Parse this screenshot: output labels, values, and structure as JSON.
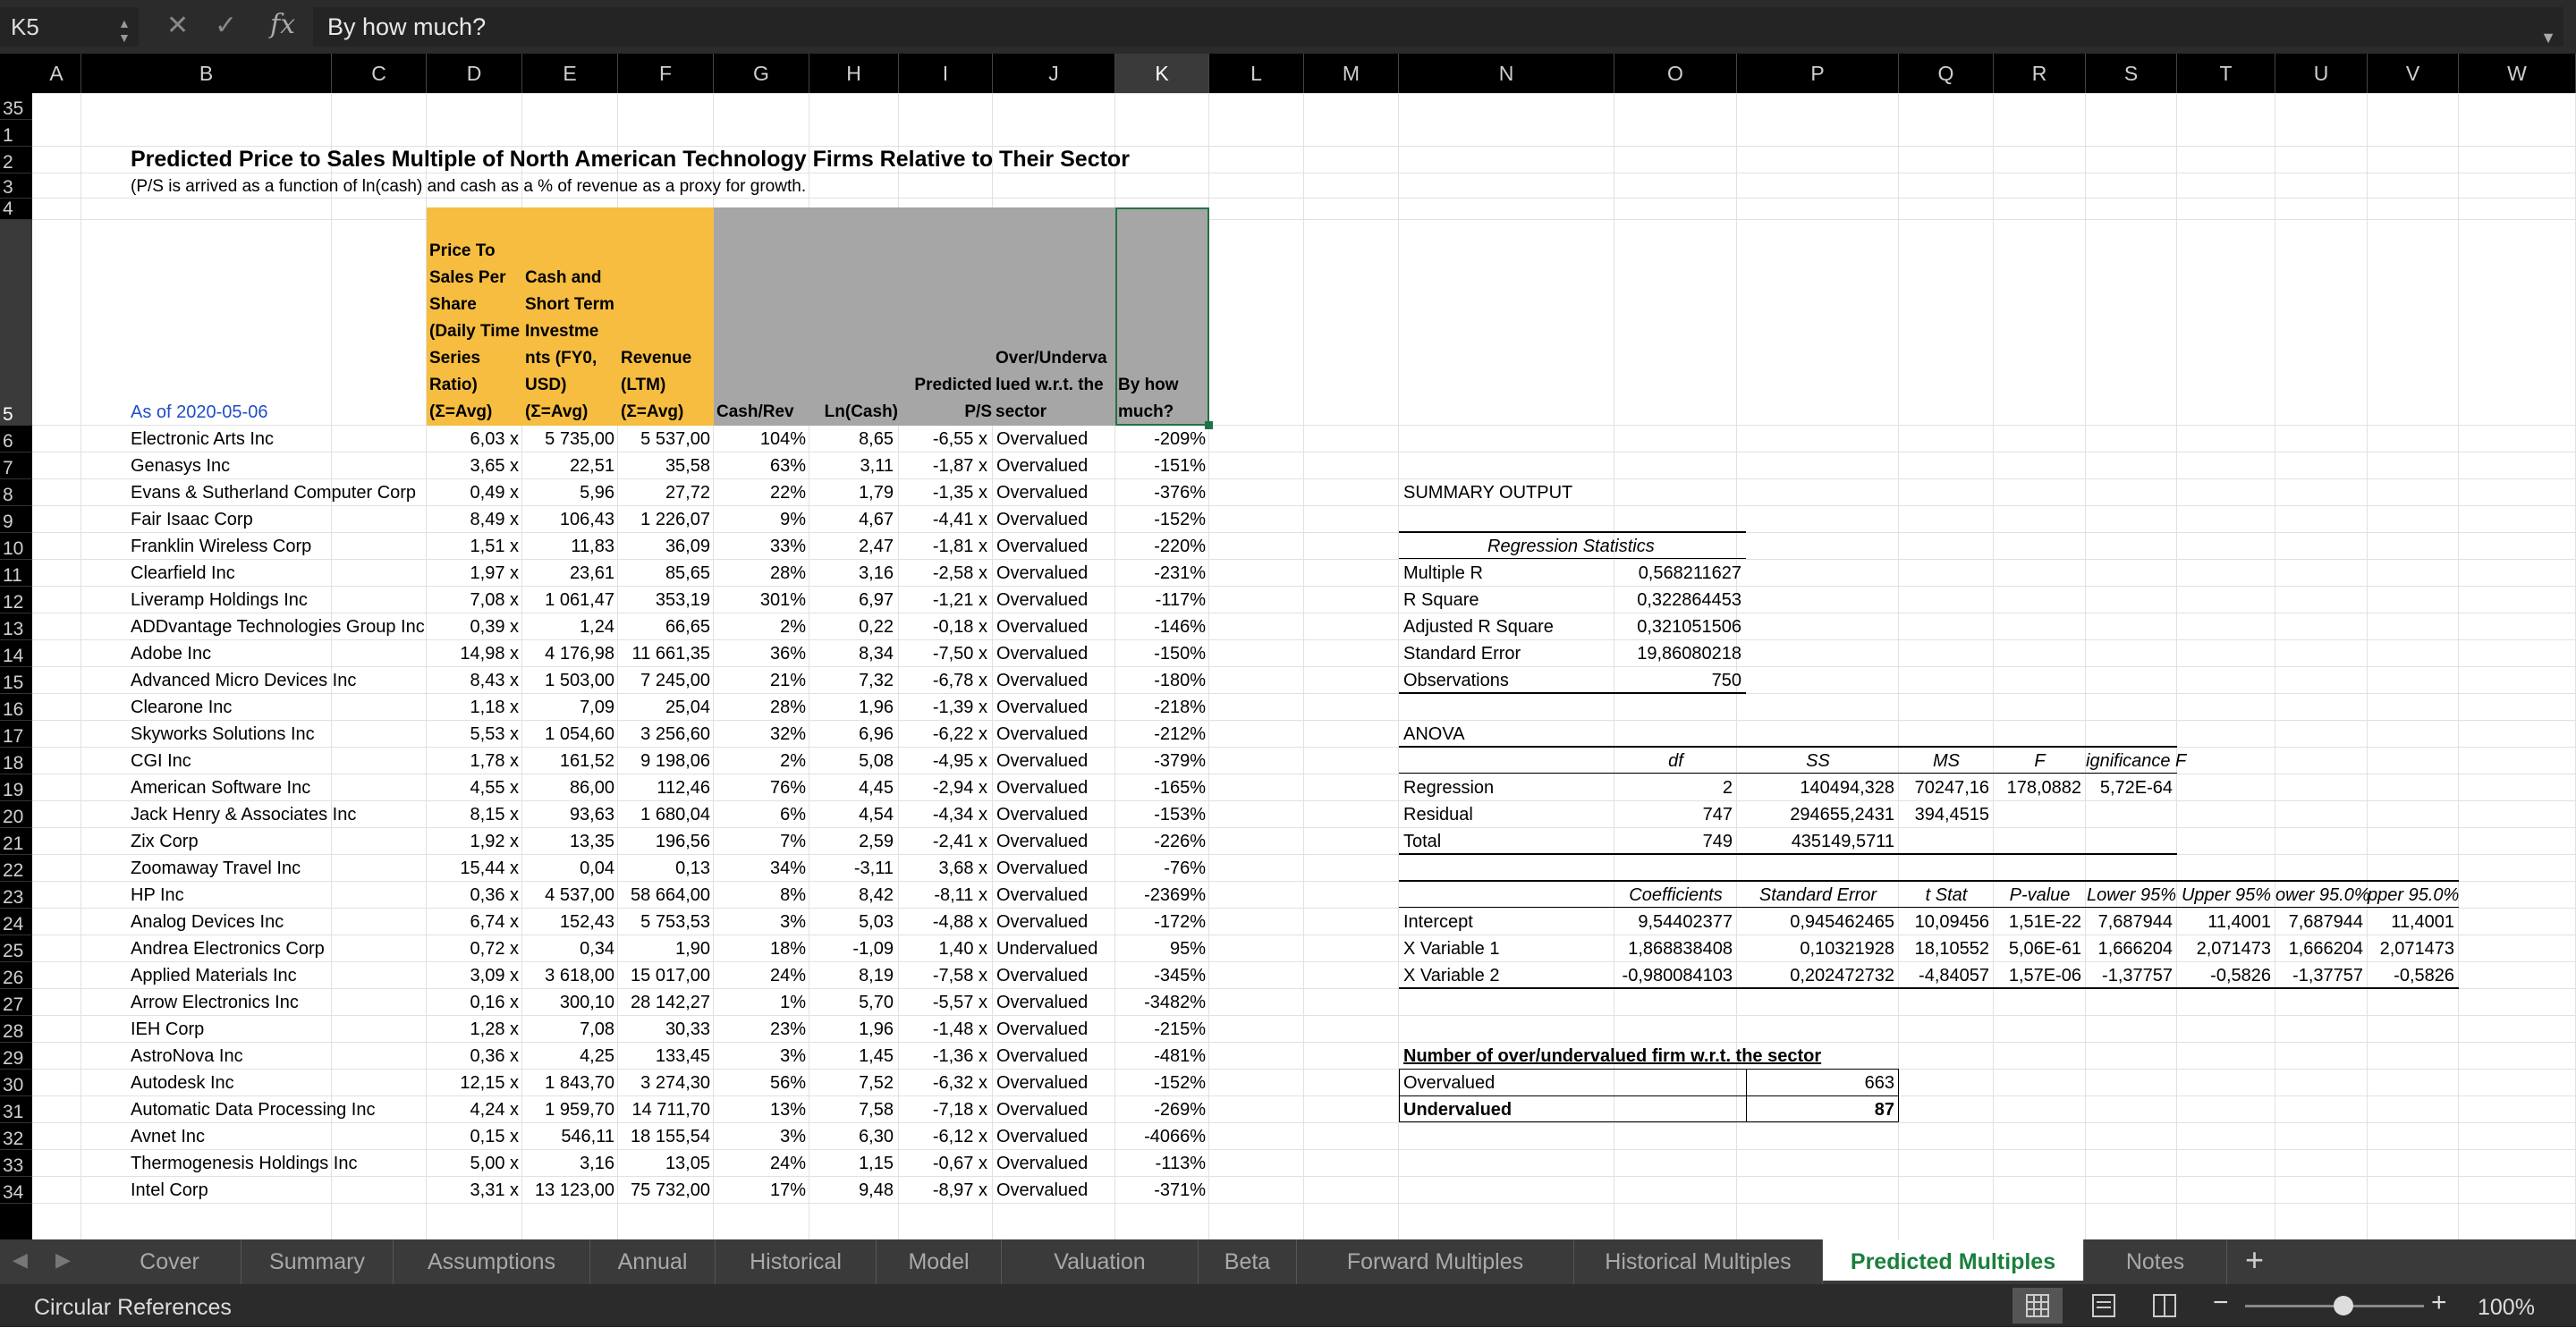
{
  "name_box": "K5",
  "formula": "By how much?",
  "columns": [
    "A",
    "B",
    "C",
    "D",
    "E",
    "F",
    "G",
    "H",
    "I",
    "J",
    "K",
    "L",
    "M",
    "N",
    "O",
    "P",
    "Q",
    "R",
    "S",
    "T",
    "U",
    "V",
    "W"
  ],
  "row_numbers": [
    "1",
    "2",
    "3",
    "4",
    "5",
    "6",
    "7",
    "8",
    "9",
    "10",
    "11",
    "12",
    "13",
    "14",
    "15",
    "16",
    "17",
    "18",
    "19",
    "20",
    "21",
    "22",
    "23",
    "24",
    "25",
    "26",
    "27",
    "28",
    "29",
    "30",
    "31",
    "32",
    "33",
    "34",
    "35"
  ],
  "title": "Predicted Price to Sales Multiple of North American Technology Firms Relative to Their Sector",
  "subtitle": "(P/S is arrived as a function of ln(cash) and cash as a % of revenue as a proxy for growth.",
  "as_of": "As of 2020-05-06",
  "headers": {
    "d": "Price To Sales Per Share (Daily Time Series Ratio) (Σ=Avg)",
    "e": "Cash and Short Term Investme nts (FY0, USD) (Σ=Avg)",
    "f": "Revenue (LTM) (Σ=Avg)",
    "g": "Cash/Rev",
    "h": "Ln(Cash)",
    "i": "Predicted P/S",
    "j": "Over/Underva lued w.r.t. the sector",
    "k": "By how much?"
  },
  "rows": [
    [
      "Electronic Arts Inc",
      "6,03 x",
      "5 735,00",
      "5 537,00",
      "104%",
      "8,65",
      "-6,55 x",
      "Overvalued",
      "-209%"
    ],
    [
      "Genasys Inc",
      "3,65 x",
      "22,51",
      "35,58",
      "63%",
      "3,11",
      "-1,87 x",
      "Overvalued",
      "-151%"
    ],
    [
      "Evans & Sutherland Computer Corp",
      "0,49 x",
      "5,96",
      "27,72",
      "22%",
      "1,79",
      "-1,35 x",
      "Overvalued",
      "-376%"
    ],
    [
      "Fair Isaac Corp",
      "8,49 x",
      "106,43",
      "1 226,07",
      "9%",
      "4,67",
      "-4,41 x",
      "Overvalued",
      "-152%"
    ],
    [
      "Franklin Wireless Corp",
      "1,51 x",
      "11,83",
      "36,09",
      "33%",
      "2,47",
      "-1,81 x",
      "Overvalued",
      "-220%"
    ],
    [
      "Clearfield Inc",
      "1,97 x",
      "23,61",
      "85,65",
      "28%",
      "3,16",
      "-2,58 x",
      "Overvalued",
      "-231%"
    ],
    [
      "Liveramp Holdings Inc",
      "7,08 x",
      "1 061,47",
      "353,19",
      "301%",
      "6,97",
      "-1,21 x",
      "Overvalued",
      "-117%"
    ],
    [
      "ADDvantage Technologies Group Inc",
      "0,39 x",
      "1,24",
      "66,65",
      "2%",
      "0,22",
      "-0,18 x",
      "Overvalued",
      "-146%"
    ],
    [
      "Adobe Inc",
      "14,98 x",
      "4 176,98",
      "11 661,35",
      "36%",
      "8,34",
      "-7,50 x",
      "Overvalued",
      "-150%"
    ],
    [
      "Advanced Micro Devices Inc",
      "8,43 x",
      "1 503,00",
      "7 245,00",
      "21%",
      "7,32",
      "-6,78 x",
      "Overvalued",
      "-180%"
    ],
    [
      "Clearone Inc",
      "1,18 x",
      "7,09",
      "25,04",
      "28%",
      "1,96",
      "-1,39 x",
      "Overvalued",
      "-218%"
    ],
    [
      "Skyworks Solutions Inc",
      "5,53 x",
      "1 054,60",
      "3 256,60",
      "32%",
      "6,96",
      "-6,22 x",
      "Overvalued",
      "-212%"
    ],
    [
      "CGI Inc",
      "1,78 x",
      "161,52",
      "9 198,06",
      "2%",
      "5,08",
      "-4,95 x",
      "Overvalued",
      "-379%"
    ],
    [
      "American Software Inc",
      "4,55 x",
      "86,00",
      "112,46",
      "76%",
      "4,45",
      "-2,94 x",
      "Overvalued",
      "-165%"
    ],
    [
      "Jack Henry & Associates Inc",
      "8,15 x",
      "93,63",
      "1 680,04",
      "6%",
      "4,54",
      "-4,34 x",
      "Overvalued",
      "-153%"
    ],
    [
      "Zix Corp",
      "1,92 x",
      "13,35",
      "196,56",
      "7%",
      "2,59",
      "-2,41 x",
      "Overvalued",
      "-226%"
    ],
    [
      "Zoomaway Travel Inc",
      "15,44 x",
      "0,04",
      "0,13",
      "34%",
      "-3,11",
      "3,68 x",
      "Overvalued",
      "-76%"
    ],
    [
      "HP Inc",
      "0,36 x",
      "4 537,00",
      "58 664,00",
      "8%",
      "8,42",
      "-8,11 x",
      "Overvalued",
      "-2369%"
    ],
    [
      "Analog Devices Inc",
      "6,74 x",
      "152,43",
      "5 753,53",
      "3%",
      "5,03",
      "-4,88 x",
      "Overvalued",
      "-172%"
    ],
    [
      "Andrea Electronics Corp",
      "0,72 x",
      "0,34",
      "1,90",
      "18%",
      "-1,09",
      "1,40 x",
      "Undervalued",
      "95%"
    ],
    [
      "Applied Materials Inc",
      "3,09 x",
      "3 618,00",
      "15 017,00",
      "24%",
      "8,19",
      "-7,58 x",
      "Overvalued",
      "-345%"
    ],
    [
      "Arrow Electronics Inc",
      "0,16 x",
      "300,10",
      "28 142,27",
      "1%",
      "5,70",
      "-5,57 x",
      "Overvalued",
      "-3482%"
    ],
    [
      "IEH Corp",
      "1,28 x",
      "7,08",
      "30,33",
      "23%",
      "1,96",
      "-1,48 x",
      "Overvalued",
      "-215%"
    ],
    [
      "AstroNova Inc",
      "0,36 x",
      "4,25",
      "133,45",
      "3%",
      "1,45",
      "-1,36 x",
      "Overvalued",
      "-481%"
    ],
    [
      "Autodesk Inc",
      "12,15 x",
      "1 843,70",
      "3 274,30",
      "56%",
      "7,52",
      "-6,32 x",
      "Overvalued",
      "-152%"
    ],
    [
      "Automatic Data Processing Inc",
      "4,24 x",
      "1 959,70",
      "14 711,70",
      "13%",
      "7,58",
      "-7,18 x",
      "Overvalued",
      "-269%"
    ],
    [
      "Avnet Inc",
      "0,15 x",
      "546,11",
      "18 155,54",
      "3%",
      "6,30",
      "-6,12 x",
      "Overvalued",
      "-4066%"
    ],
    [
      "Thermogenesis Holdings Inc",
      "5,00 x",
      "3,16",
      "13,05",
      "24%",
      "1,15",
      "-0,67 x",
      "Overvalued",
      "-113%"
    ],
    [
      "Intel Corp",
      "3,31 x",
      "13 123,00",
      "75 732,00",
      "17%",
      "9,48",
      "-8,97 x",
      "Overvalued",
      "-371%"
    ]
  ],
  "summary": {
    "title": "SUMMARY OUTPUT",
    "reg_title": "Regression Statistics",
    "reg_stats": [
      [
        "Multiple R",
        "0,568211627"
      ],
      [
        "R Square",
        "0,322864453"
      ],
      [
        "Adjusted R Square",
        "0,321051506"
      ],
      [
        "Standard Error",
        "19,86080218"
      ],
      [
        "Observations",
        "750"
      ]
    ],
    "anova_title": "ANOVA",
    "anova_headers": [
      "df",
      "SS",
      "MS",
      "F",
      "ignificance F"
    ],
    "anova_rows": [
      [
        "Regression",
        "2",
        "140494,328",
        "70247,16",
        "178,0882",
        "5,72E-64"
      ],
      [
        "Residual",
        "747",
        "294655,2431",
        "394,4515",
        "",
        ""
      ],
      [
        "Total",
        "749",
        "435149,5711",
        "",
        "",
        ""
      ]
    ],
    "coef_headers": [
      "Coefficients",
      "Standard Error",
      "t Stat",
      "P-value",
      "Lower 95%",
      "Upper 95%",
      "ower 95.0%",
      "pper 95.0%"
    ],
    "coef_rows": [
      [
        "Intercept",
        "9,54402377",
        "0,945462465",
        "10,09456",
        "1,51E-22",
        "7,687944",
        "11,4001",
        "7,687944",
        "11,4001"
      ],
      [
        "X Variable 1",
        "1,868838408",
        "0,10321928",
        "18,10552",
        "5,06E-61",
        "1,666204",
        "2,071473",
        "1,666204",
        "2,071473"
      ],
      [
        "X Variable 2",
        "-0,980084103",
        "0,202472732",
        "-4,84057",
        "1,57E-06",
        "-1,37757",
        "-0,5826",
        "-1,37757",
        "-0,5826"
      ]
    ],
    "count_title": "Number of over/undervalued firm w.r.t. the sector",
    "count_rows": [
      [
        "Overvalued",
        "663"
      ],
      [
        "Undervalued",
        "87"
      ]
    ]
  },
  "tabs": [
    "Cover",
    "Summary",
    "Assumptions",
    "Annual",
    "Historical",
    "Model",
    "Valuation",
    "Beta",
    "Forward Multiples",
    "Historical Multiples",
    "Predicted Multiples",
    "Notes"
  ],
  "active_tab": "Predicted Multiples",
  "add_tab_label": "+",
  "status_text": "Circular References",
  "zoom": "100%",
  "zoom_level": 0.55
}
